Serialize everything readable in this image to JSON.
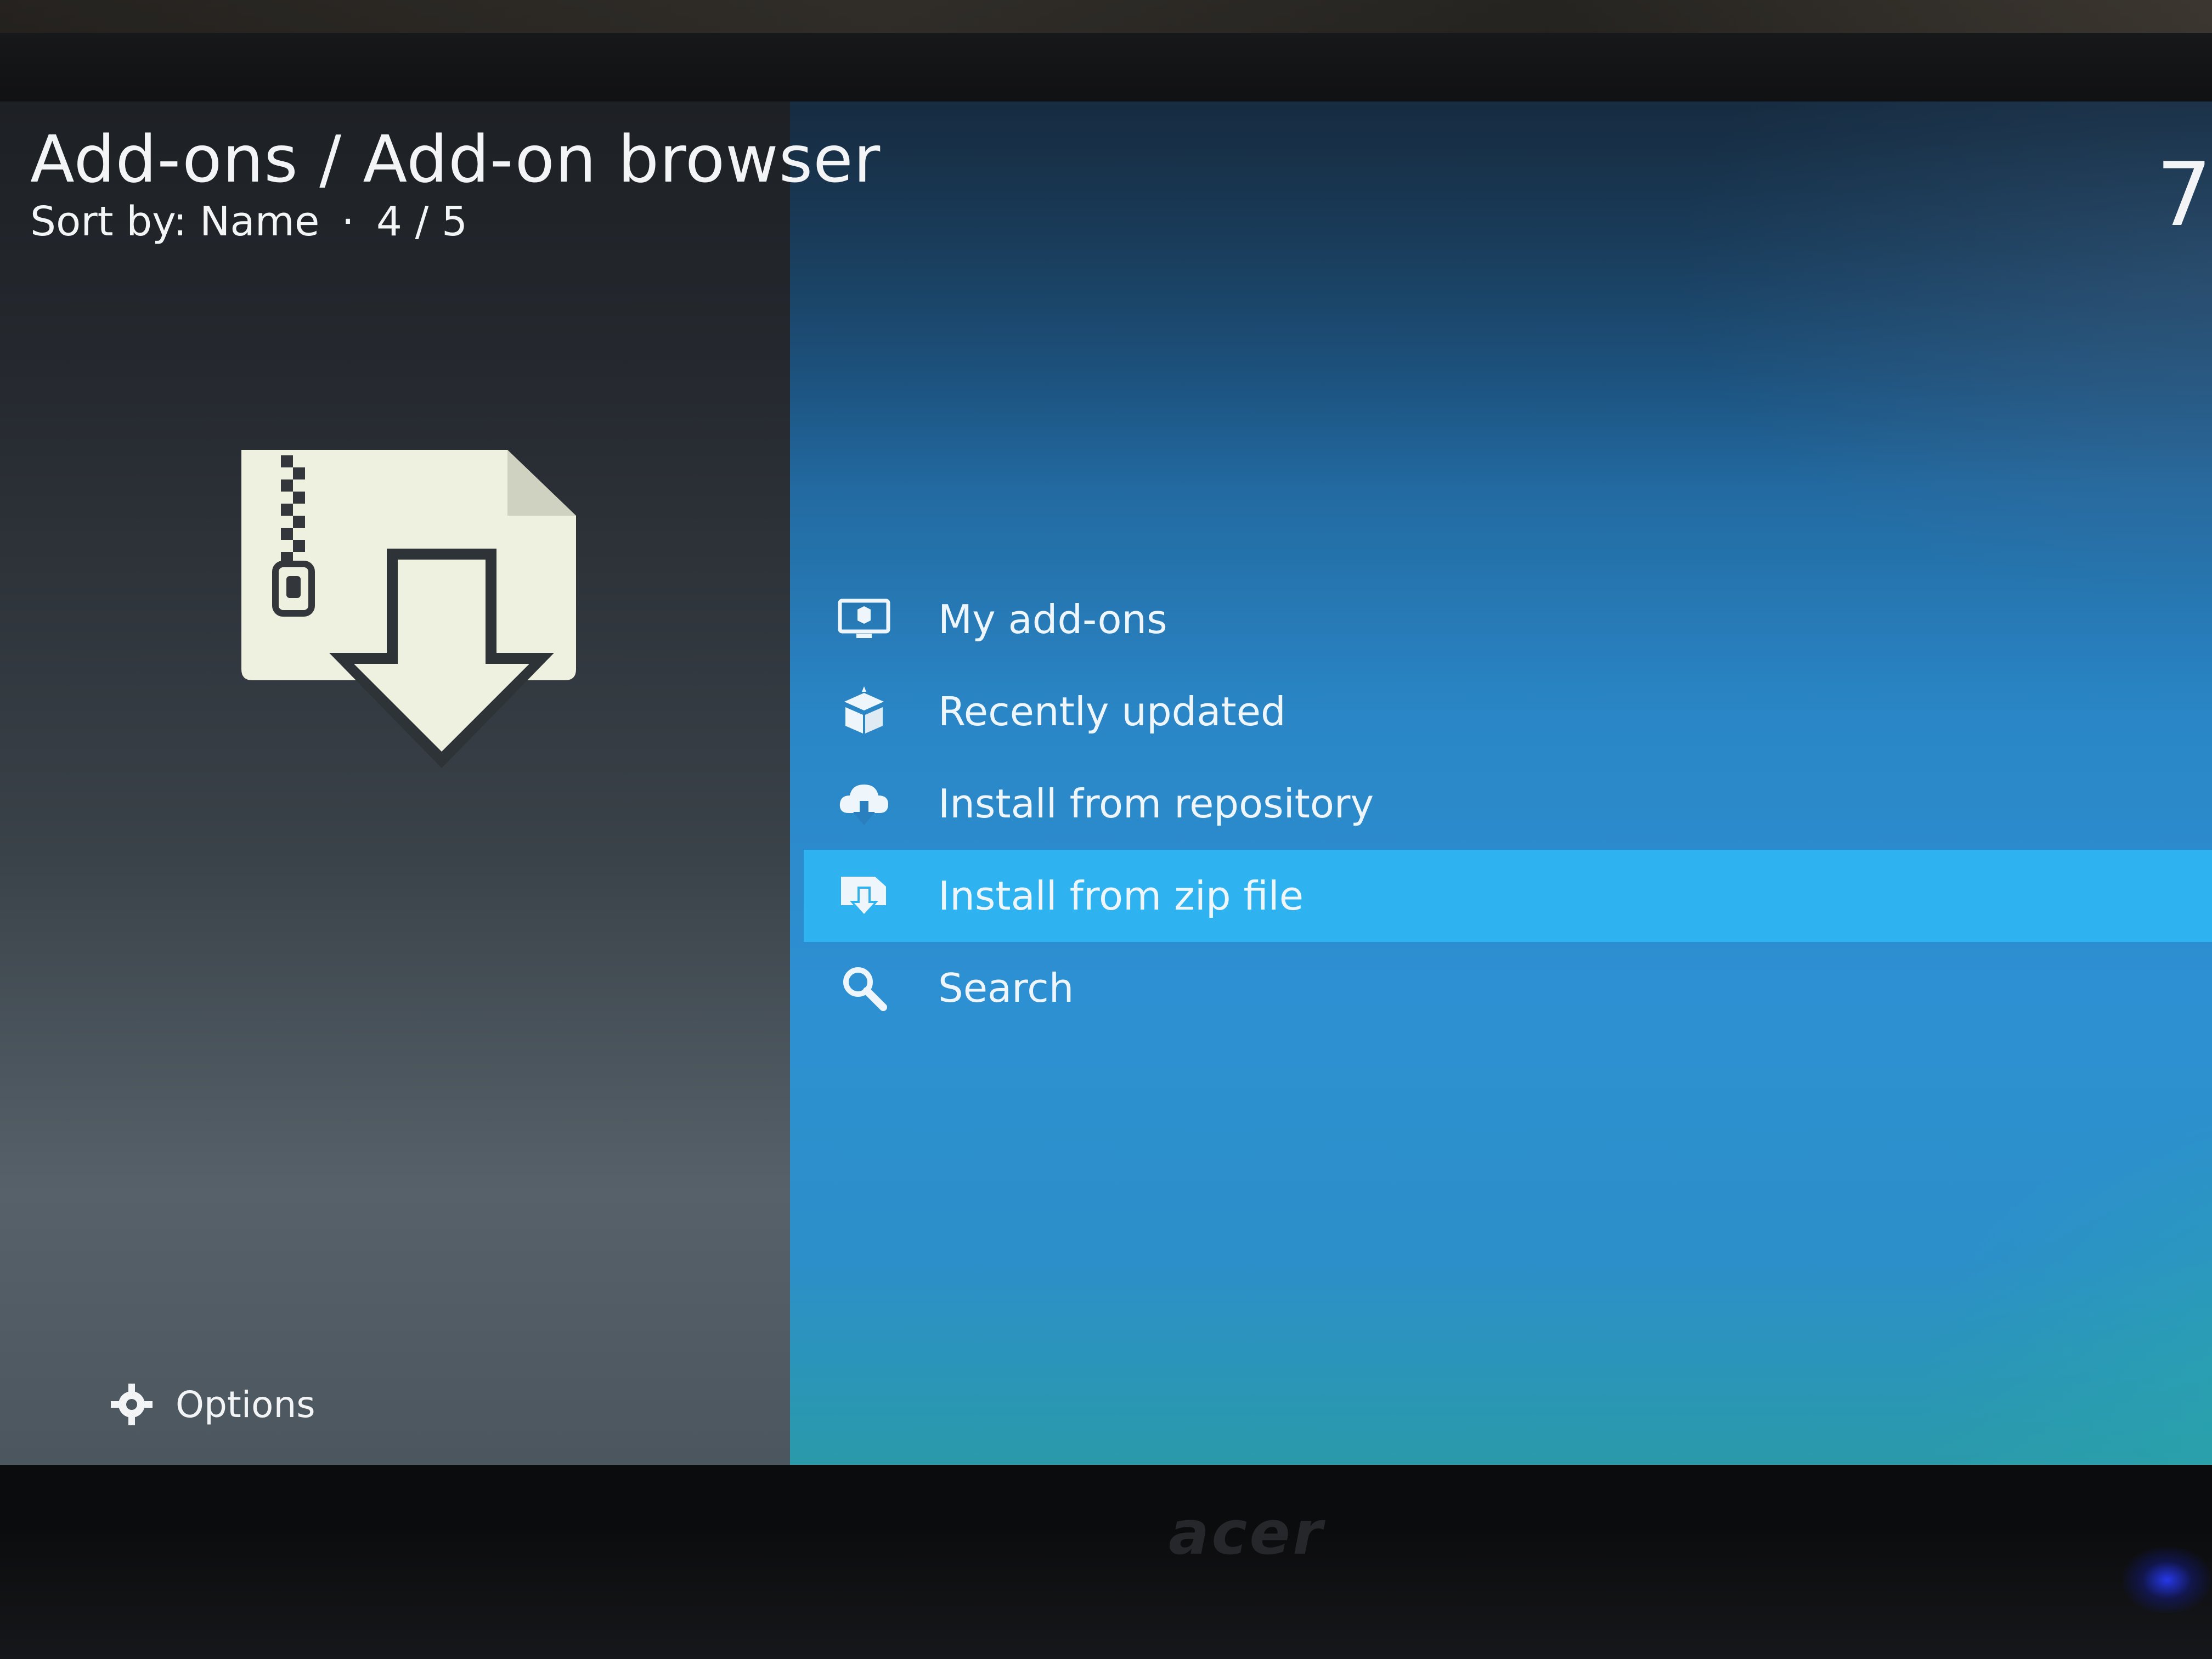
{
  "header": {
    "title": "Add-ons / Add-on browser",
    "sort_label": "Sort by: Name",
    "separator": "·",
    "position": "4 / 5",
    "corner_glyph": "7"
  },
  "menu": {
    "items": [
      {
        "label": "My add-ons",
        "icon": "monitor-box-icon",
        "focused": false
      },
      {
        "label": "Recently updated",
        "icon": "open-box-icon",
        "focused": false
      },
      {
        "label": "Install from repository",
        "icon": "cloud-download-icon",
        "focused": false
      },
      {
        "label": "Install from zip file",
        "icon": "zip-download-icon",
        "focused": true
      },
      {
        "label": "Search",
        "icon": "search-icon",
        "focused": false
      }
    ]
  },
  "options": {
    "label": "Options",
    "icon": "options-gear-icon"
  },
  "preview": {
    "icon": "zip-file-download-icon"
  },
  "bezel": {
    "brand": "acer"
  },
  "colors": {
    "focus_highlight": "#2fb3f0",
    "text": "#eef6fb",
    "left_panel_top": "#1d2024",
    "right_panel_mid": "#2a86c6"
  }
}
